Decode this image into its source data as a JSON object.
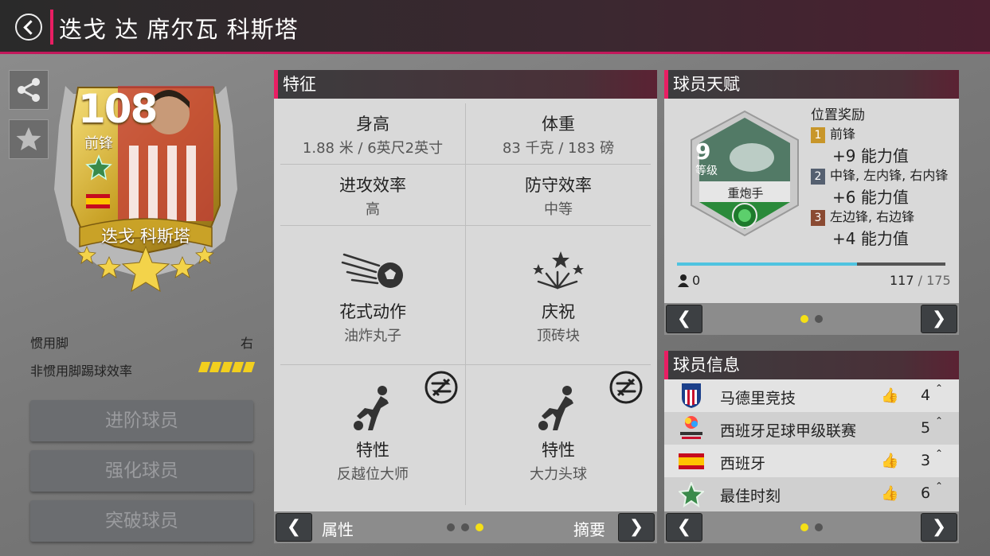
{
  "header": {
    "title": "迭戈 达 席尔瓦 科斯塔"
  },
  "card": {
    "rating": "108",
    "position": "前锋",
    "name": "迭戈 科斯塔"
  },
  "player_meta": {
    "preferred_foot_label": "惯用脚",
    "preferred_foot_value": "右",
    "weak_foot_label": "非惯用脚踢球效率",
    "weak_foot_stars": 5
  },
  "actions": [
    "进阶球员",
    "强化球员",
    "突破球员"
  ],
  "traits_panel": {
    "title": "特征",
    "height_label": "身高",
    "height_value": "1.88 米 / 6英尺2英寸",
    "weight_label": "体重",
    "weight_value": "83 千克 / 183 磅",
    "attack_label": "进攻效率",
    "attack_value": "高",
    "defense_label": "防守效率",
    "defense_value": "中等",
    "skill_label": "花式动作",
    "skill_value": "油炸丸子",
    "celebration_label": "庆祝",
    "celebration_value": "顶砖块",
    "trait1_label": "特性",
    "trait1_value": "反越位大师",
    "trait2_label": "特性",
    "trait2_value": "大力头球",
    "nav_left": "属性",
    "nav_right": "摘要"
  },
  "talent_panel": {
    "title": "球员天赋",
    "badge_level": "9",
    "badge_level_label": "等级",
    "badge_name": "重炮手",
    "reward_title": "位置奖励",
    "rewards": [
      {
        "num": "1",
        "pos": "前锋",
        "bonus": "+9 能力值",
        "color": "#c8962a"
      },
      {
        "num": "2",
        "pos": "中锋, 左内锋, 右内锋",
        "bonus": "+6 能力值",
        "color": "#556070"
      },
      {
        "num": "3",
        "pos": "左边锋, 右边锋",
        "bonus": "+4 能力值",
        "color": "#8a4a32"
      }
    ],
    "progress_fraction": 0.67,
    "points": "0",
    "xp_current": "117",
    "xp_total": "/ 175"
  },
  "info_panel": {
    "title": "球员信息",
    "rows": [
      {
        "name": "马德里竞技",
        "count": "4",
        "hand": true
      },
      {
        "name": "西班牙足球甲级联赛",
        "count": "5",
        "hand": false
      },
      {
        "name": "西班牙",
        "count": "3",
        "hand": true
      },
      {
        "name": "最佳时刻",
        "count": "6",
        "hand": true
      }
    ]
  },
  "colors": {
    "accent": "#e91e63",
    "gold": "#c9a227",
    "dot_active": "#f5e016",
    "progress": "#4fc3e0"
  }
}
